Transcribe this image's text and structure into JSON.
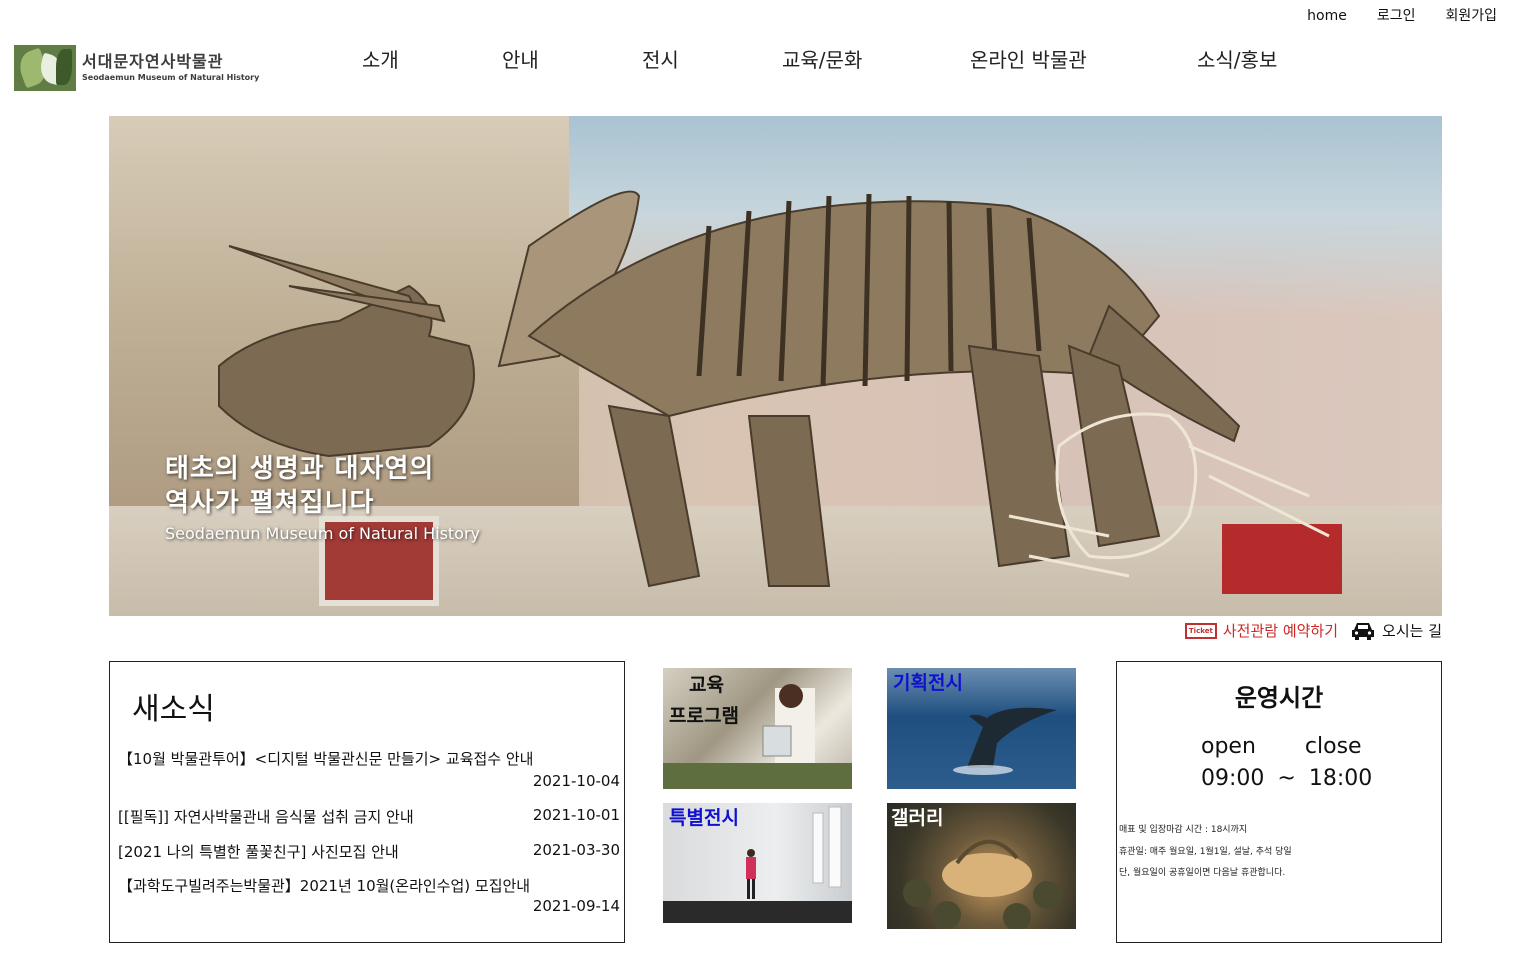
{
  "util_links": {
    "home": "home",
    "login": "로그인",
    "signup": "회원가입"
  },
  "logo": {
    "ko": "서대문자연사박물관",
    "en": "Seodaemun Museum of Natural History"
  },
  "nav": [
    "소개",
    "안내",
    "전시",
    "교육/문화",
    "온라인 박물관",
    "소식/홍보"
  ],
  "hero": {
    "line1": "태초의 생명과 대자연의",
    "line2": "역사가 펼쳐집니다",
    "en": "Seodaemun Museum of Natural History"
  },
  "quick": {
    "ticket_icon": "Ticket",
    "reserve": "사전관람 예약하기",
    "directions": "오시는 길"
  },
  "news": {
    "title": "새소식",
    "items": [
      {
        "title": "【10월 박물관투어】<디지털 박물관신문 만들기> 교육접수 안내",
        "date": "2021-10-04"
      },
      {
        "title": "[[필독]] 자연사박물관내 음식물 섭취 금지 안내",
        "date": "2021-10-01"
      },
      {
        "title": "[2021 나의 특별한 풀꽃친구] 사진모집 안내",
        "date": "2021-03-30"
      },
      {
        "title": "【과학도구빌려주는박물관】2021년 10월(온라인수업) 모집안내",
        "date": "2021-09-14"
      }
    ]
  },
  "tiles": {
    "edu_line1": "교육",
    "edu_line2": "프로그램",
    "plan": "기획전시",
    "special": "특별전시",
    "gallery": "갤러리"
  },
  "hours": {
    "title": "운영시간",
    "open_label": "open",
    "close_label": "close",
    "open_time": "09:00",
    "separator": "~",
    "close_time": "18:00",
    "notes": [
      "매표 및 입장마감 시간 : 18시까지",
      "휴관일: 매주 월요일, 1월1일, 설날, 추석 당일",
      "단, 월요일이 공휴일이면 다음날 휴관합니다."
    ]
  },
  "colors": {
    "reserve": "#d02828",
    "tile_blue": "#1010d0"
  }
}
